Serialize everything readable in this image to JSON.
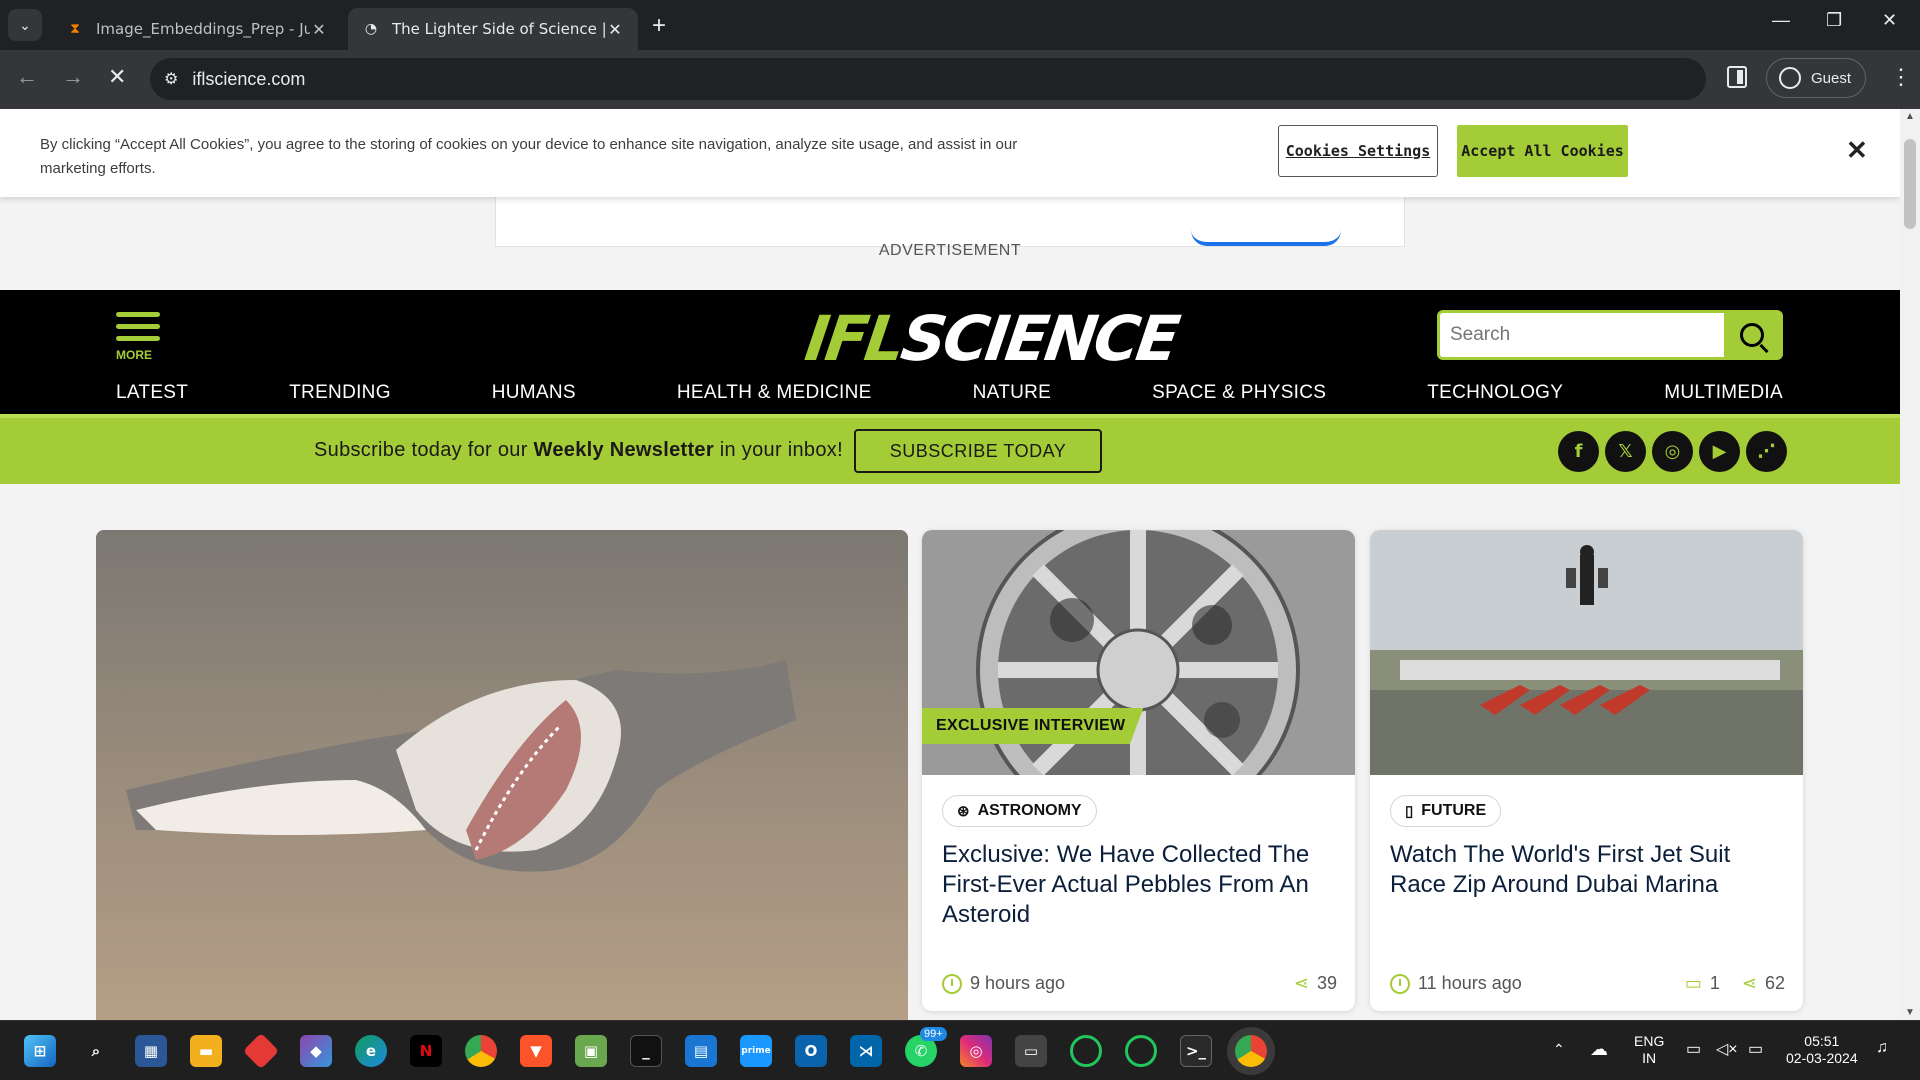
{
  "browser": {
    "tabs": [
      {
        "title": "Image_Embeddings_Prep - Jupy",
        "state": "inactive",
        "icon": "hourglass-icon"
      },
      {
        "title": "The Lighter Side of Science | IFL",
        "state": "active",
        "icon": "loading-icon"
      }
    ],
    "url": "iflscience.com",
    "profile_label": "Guest"
  },
  "cookie_banner": {
    "message": "By clicking “Accept All Cookies”, you agree to the storing of cookies on your device to enhance site navigation, analyze site usage, and assist in our marketing efforts.",
    "settings_label": "Cookies Settings",
    "accept_label": "Accept All Cookies",
    "close_label": "✕"
  },
  "ad": {
    "label": "ADVERTISEMENT"
  },
  "header": {
    "more_label": "MORE",
    "logo_part1": "IFL",
    "logo_part2": "SCIENCE",
    "search_placeholder": "Search",
    "nav": [
      "LATEST",
      "TRENDING",
      "HUMANS",
      "HEALTH & MEDICINE",
      "NATURE",
      "SPACE & PHYSICS",
      "TECHNOLOGY",
      "MULTIMEDIA"
    ]
  },
  "subscribe": {
    "text_before": "Subscribe today for our ",
    "text_bold": "Weekly Newsletter",
    "text_after": " in your inbox!",
    "button": "SUBSCRIBE TODAY",
    "socials": [
      "facebook-icon",
      "x-icon",
      "instagram-icon",
      "youtube-icon",
      "rss-icon"
    ]
  },
  "articles": [
    {
      "badge": "EXCLUSIVE INTERVIEW",
      "category": "ASTRONOMY",
      "headline": "Exclusive: We Have Collected The First-Ever Actual Pebbles From An Asteroid",
      "time": "9 hours ago",
      "shares": "39"
    },
    {
      "category": "FUTURE",
      "headline": "Watch The World's First Jet Suit Race Zip Around Dubai Marina",
      "time": "11 hours ago",
      "comments": "1",
      "shares": "62"
    }
  ],
  "taskbar": {
    "whatsapp_badge": "99+",
    "lang_line1": "ENG",
    "lang_line2": "IN",
    "time": "05:51",
    "date": "02-03-2024"
  },
  "colors": {
    "accent": "#a4cc37",
    "header_bg": "#000000",
    "chrome_dark": "#202124"
  }
}
